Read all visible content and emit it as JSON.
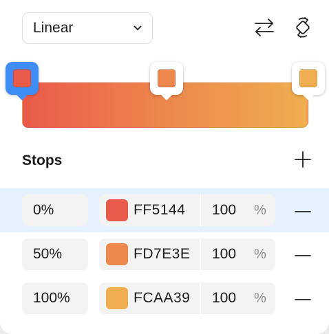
{
  "header": {
    "type_value": "Linear",
    "icons": {
      "dropdown": "chevron-down-icon",
      "swap": "swap-arrows-icon",
      "rotate": "rotate-icon"
    }
  },
  "stops": {
    "title": "Stops",
    "add_icon": "plus-icon",
    "remove_icon": "minus-icon",
    "percent_sign": "%",
    "items": [
      {
        "position": "0%",
        "hex": "FF5144",
        "opacity": "100",
        "color": "#EA5A4A",
        "selected": true
      },
      {
        "position": "50%",
        "hex": "FD7E3E",
        "opacity": "100",
        "color": "#ED874D",
        "selected": false
      },
      {
        "position": "100%",
        "hex": "FCAA39",
        "opacity": "100",
        "color": "#EFAE4F",
        "selected": false
      }
    ]
  },
  "colors": {
    "accent": "#3D8DF5",
    "selected_row": "#E5F1FD",
    "field_bg": "#F3F3F3"
  }
}
